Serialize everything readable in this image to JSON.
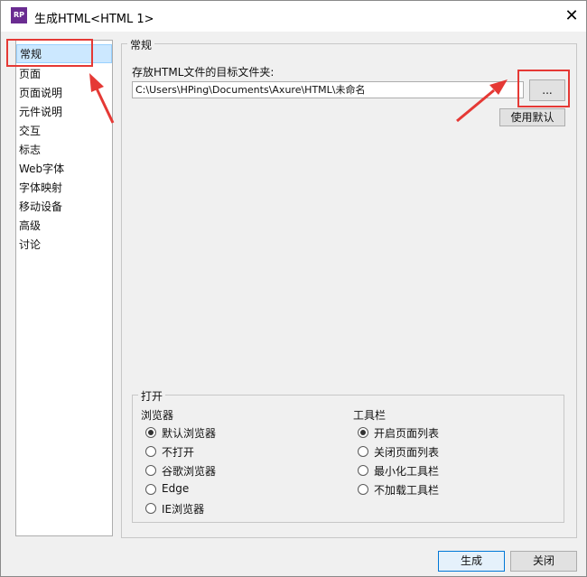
{
  "window": {
    "title": "生成HTML<HTML 1>",
    "icon_text": "RP",
    "close_glyph": "✕"
  },
  "sidebar": {
    "items": [
      {
        "label": "常规",
        "selected": true
      },
      {
        "label": "页面"
      },
      {
        "label": "页面说明"
      },
      {
        "label": "元件说明"
      },
      {
        "label": "交互"
      },
      {
        "label": "标志"
      },
      {
        "label": "Web字体"
      },
      {
        "label": "字体映射"
      },
      {
        "label": "移动设备"
      },
      {
        "label": "高级"
      },
      {
        "label": "讨论"
      }
    ]
  },
  "general": {
    "section_title": "常规",
    "folder_label": "存放HTML文件的目标文件夹:",
    "folder_path": "C:\\Users\\HPing\\Documents\\Axure\\HTML\\未命名",
    "browse_label": "...",
    "use_default_label": "使用默认"
  },
  "open_group": {
    "title": "打开",
    "browser": {
      "heading": "浏览器",
      "options": [
        "默认浏览器",
        "不打开",
        "谷歌浏览器",
        "Edge",
        "IE浏览器"
      ],
      "selected": "默认浏览器"
    },
    "toolbar": {
      "heading": "工具栏",
      "options": [
        "开启页面列表",
        "关闭页面列表",
        "最小化工具栏",
        "不加载工具栏"
      ],
      "selected": "开启页面列表"
    }
  },
  "footer": {
    "generate_label": "生成",
    "close_label": "关闭"
  },
  "annotation_color": "#e53935"
}
